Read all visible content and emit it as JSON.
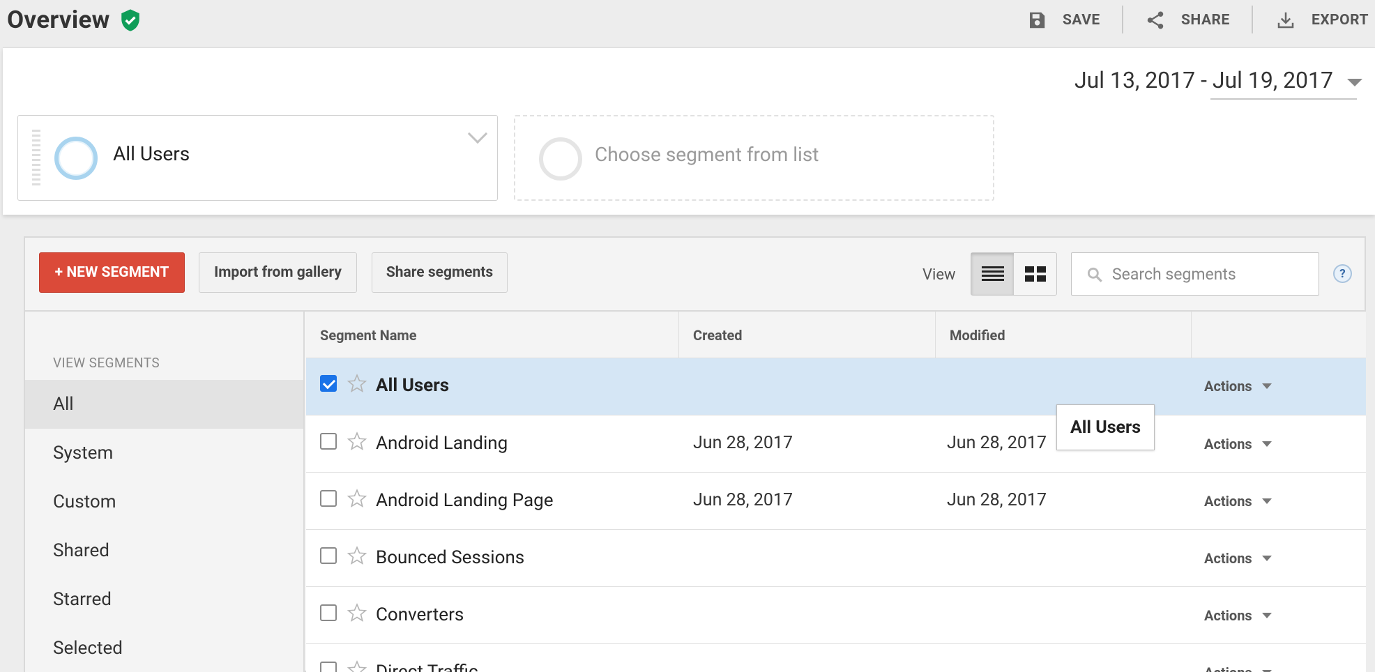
{
  "header": {
    "title": "Overview",
    "actions": {
      "save": "SAVE",
      "share": "SHARE",
      "export": "EXPORT"
    }
  },
  "date_range": "Jul 13, 2017 - Jul 19, 2017",
  "segments": {
    "primary": "All Users",
    "placeholder": "Choose segment from list"
  },
  "toolbar": {
    "new_segment": "+ NEW SEGMENT",
    "import": "Import from gallery",
    "share": "Share segments",
    "view_label": "View",
    "search_placeholder": "Search segments",
    "help": "?"
  },
  "sidebar": {
    "heading": "VIEW SEGMENTS",
    "items": [
      "All",
      "System",
      "Custom",
      "Shared",
      "Starred",
      "Selected"
    ],
    "active": "All"
  },
  "table": {
    "columns": [
      "Segment Name",
      "Created",
      "Modified"
    ],
    "actions_label": "Actions",
    "rows": [
      {
        "name": "All Users",
        "created": "",
        "modified": "",
        "checked": true
      },
      {
        "name": "Android Landing",
        "created": "Jun 28, 2017",
        "modified": "Jun 28, 2017",
        "checked": false
      },
      {
        "name": "Android Landing Page",
        "created": "Jun 28, 2017",
        "modified": "Jun 28, 2017",
        "checked": false
      },
      {
        "name": "Bounced Sessions",
        "created": "",
        "modified": "",
        "checked": false
      },
      {
        "name": "Converters",
        "created": "",
        "modified": "",
        "checked": false
      },
      {
        "name": "Direct Traffic",
        "created": "",
        "modified": "",
        "checked": false
      }
    ]
  },
  "tooltip": "All Users",
  "colors": {
    "accent_red": "#db4a39",
    "selected_row": "#d5e6f5",
    "shield_green": "#0f9d58",
    "segment_ring": "#a9d4ef"
  }
}
